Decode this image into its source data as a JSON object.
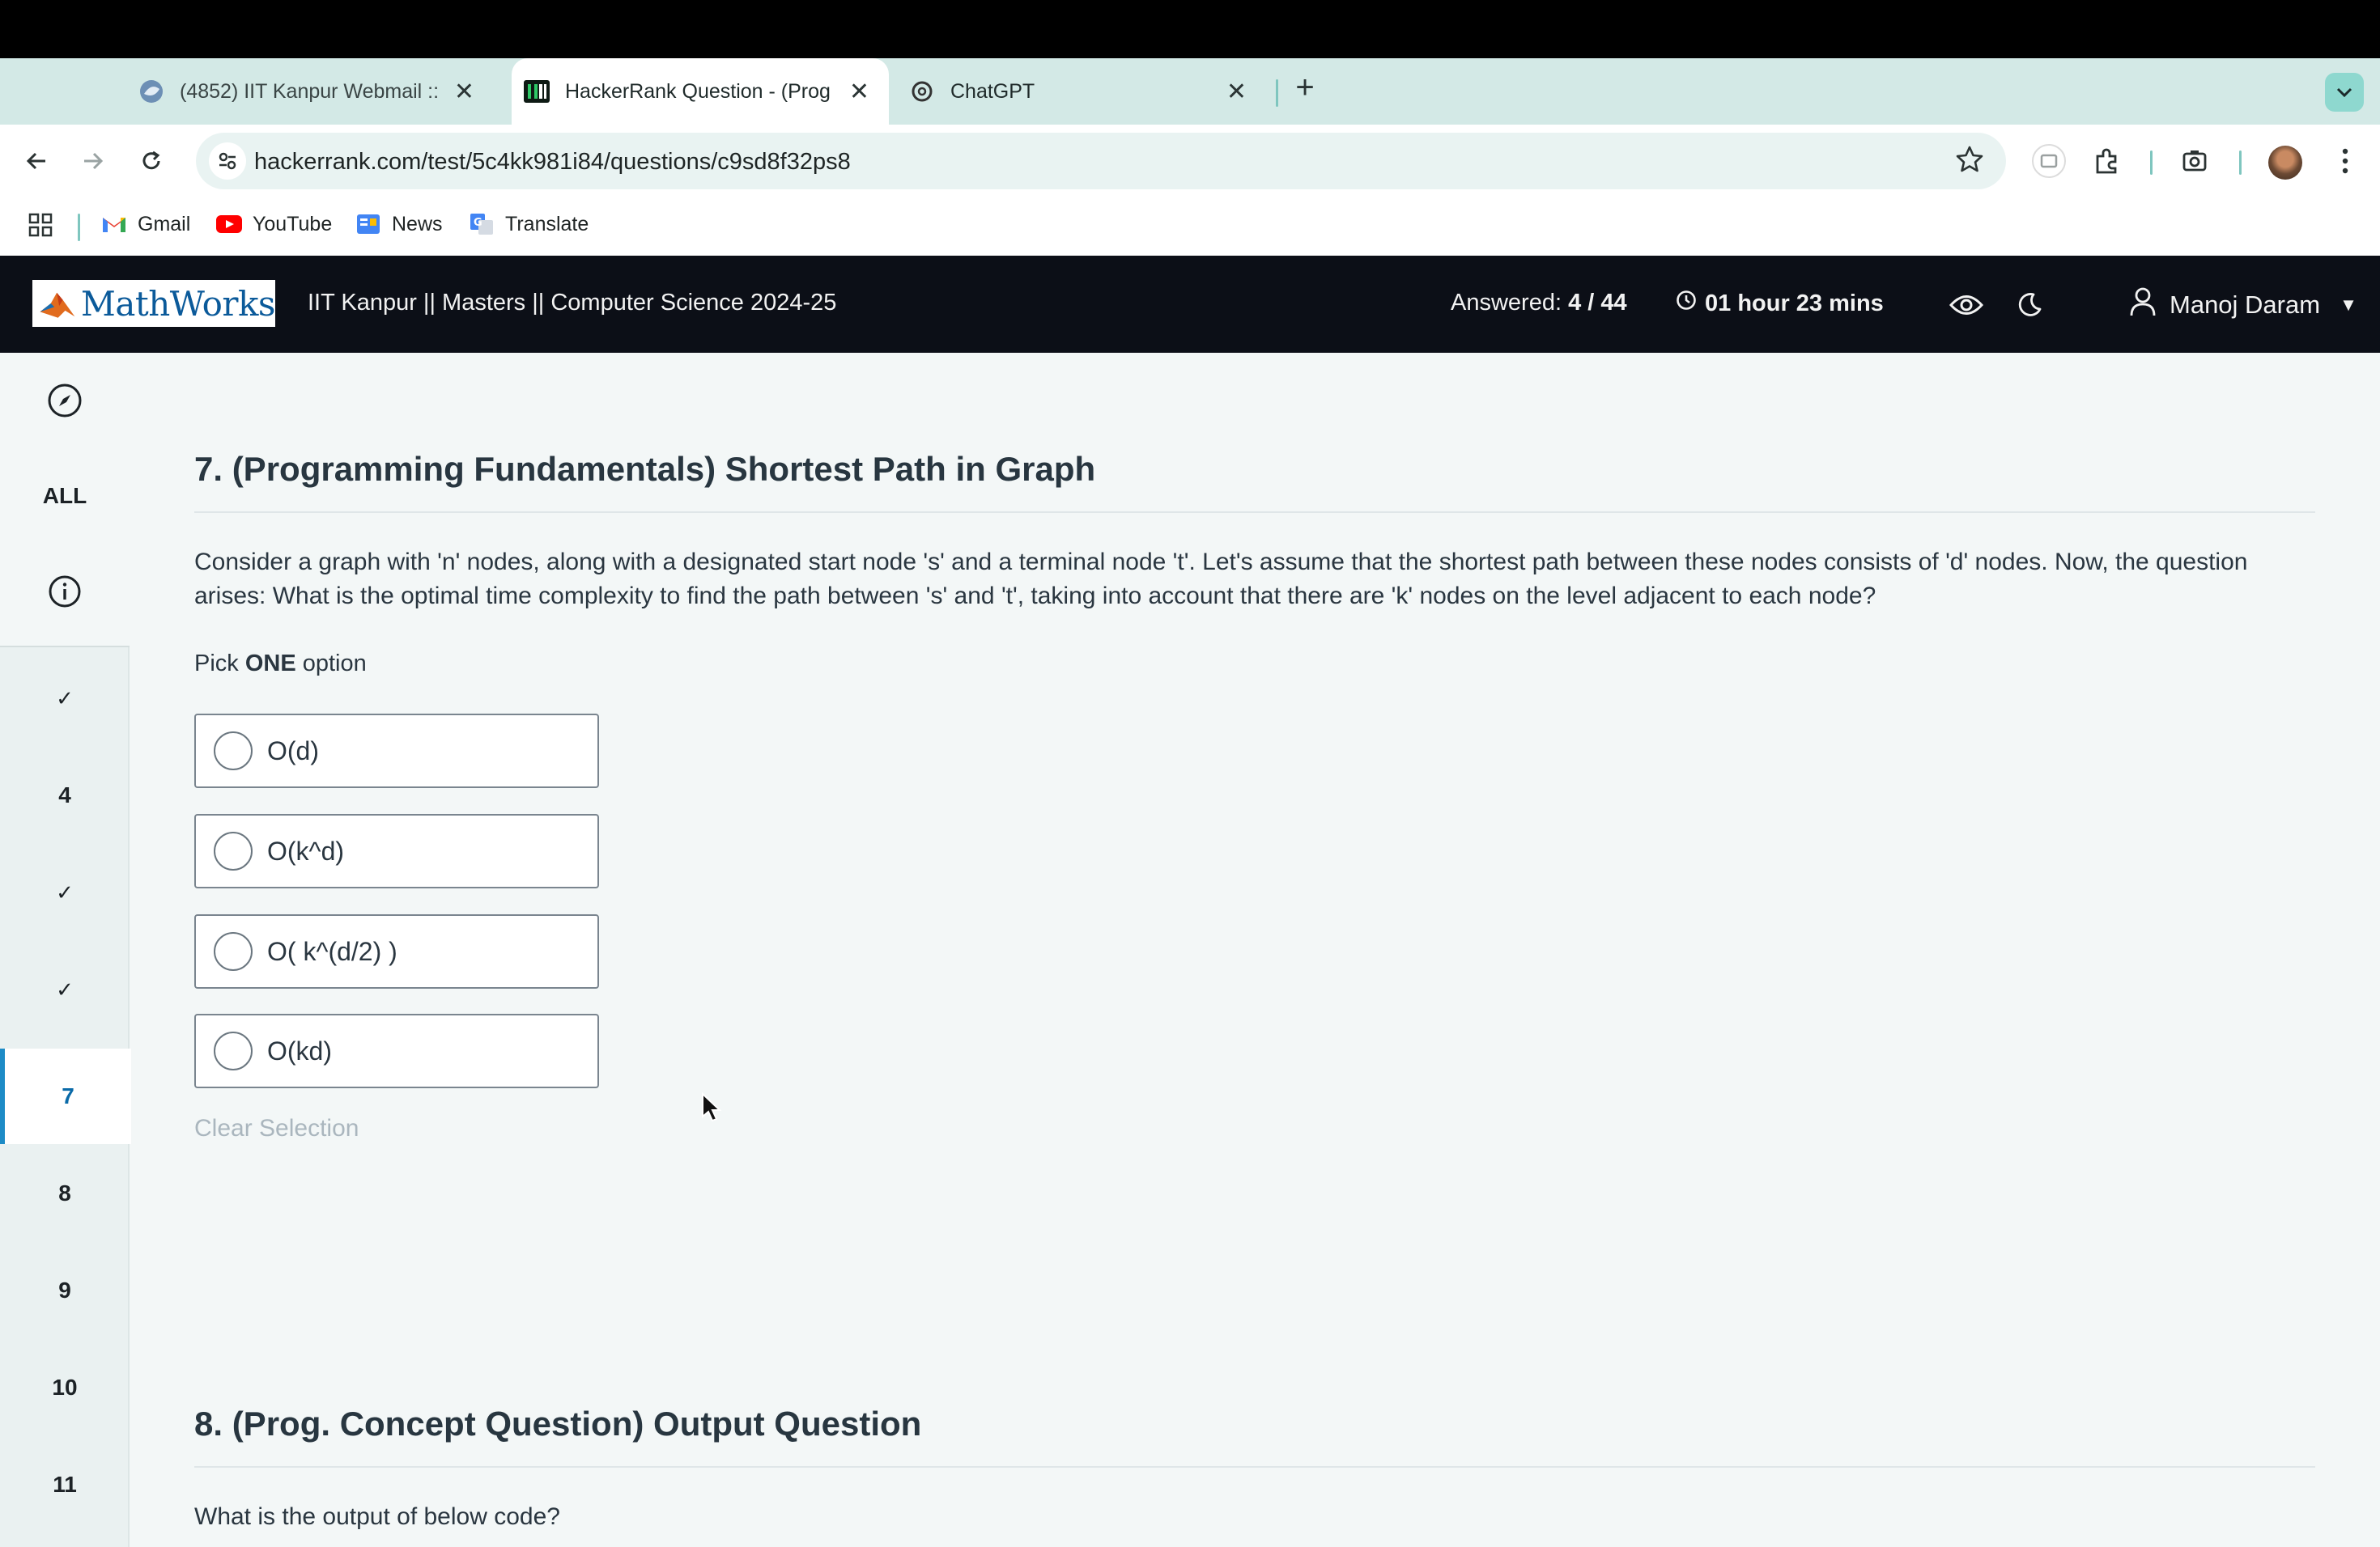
{
  "browser": {
    "tabs": [
      {
        "title": "(4852) IIT Kanpur Webmail ::",
        "icon": "webmail-icon",
        "active": false
      },
      {
        "title": "HackerRank Question - (Prog",
        "icon": "hackerrank-icon",
        "active": true
      },
      {
        "title": "ChatGPT",
        "icon": "chatgpt-icon",
        "active": false
      }
    ],
    "url": "hackerrank.com/test/5c4kk981i84/questions/c9sd8f32ps8",
    "bookmarks": [
      {
        "label": "Gmail",
        "icon": "gmail-icon"
      },
      {
        "label": "YouTube",
        "icon": "youtube-icon"
      },
      {
        "label": "News",
        "icon": "news-icon"
      },
      {
        "label": "Translate",
        "icon": "translate-icon"
      }
    ]
  },
  "header": {
    "logo_text": "MathWorks",
    "test_title": "IIT Kanpur || Masters || Computer Science 2024-25",
    "answered_label": "Answered: ",
    "answered_value": "4 / 44",
    "timer": "01 hour 23 mins",
    "user_name": "Manoj Daram"
  },
  "sidebar": {
    "all_label": "ALL",
    "items": [
      {
        "label": "✓",
        "state": "answered"
      },
      {
        "label": "4",
        "state": "unanswered"
      },
      {
        "label": "✓",
        "state": "answered"
      },
      {
        "label": "✓",
        "state": "answered"
      },
      {
        "label": "7",
        "state": "current"
      },
      {
        "label": "8",
        "state": "unanswered"
      },
      {
        "label": "9",
        "state": "unanswered"
      },
      {
        "label": "10",
        "state": "unanswered"
      },
      {
        "label": "11",
        "state": "unanswered"
      }
    ]
  },
  "question7": {
    "heading": "7. (Programming Fundamentals) Shortest Path in Graph",
    "body": "Consider a graph with 'n' nodes, along with a designated start node 's' and a terminal node 't'. Let's assume that the shortest path between these nodes consists of 'd' nodes. Now, the question arises: What is the optimal time complexity to find the path between 's' and 't', taking into account that there are 'k' nodes on the level adjacent to each node?",
    "pick_prefix": "Pick ",
    "pick_bold": "ONE",
    "pick_suffix": " option",
    "options": [
      "O(d)",
      "O(k^d)",
      "O( k^(d/2) )",
      "O(kd)"
    ],
    "clear_selection": "Clear Selection"
  },
  "question8": {
    "heading": "8. (Prog. Concept Question) Output Question",
    "body": "What is the output of below code?"
  },
  "colors": {
    "header_bg": "#0c0f17",
    "tab_strip_bg": "#d3e9e6",
    "active_accent": "#1d8bc6",
    "page_bg": "#f3f7f7"
  }
}
